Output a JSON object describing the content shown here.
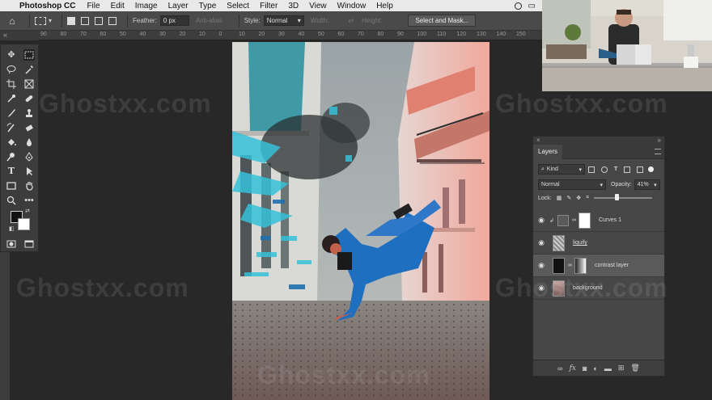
{
  "menubar": {
    "app_name": "Photoshop CC",
    "items": [
      "File",
      "Edit",
      "Image",
      "Layer",
      "Type",
      "Select",
      "Filter",
      "3D",
      "View",
      "Window",
      "Help"
    ]
  },
  "options_bar": {
    "feather_label": "Feather:",
    "feather_value": "0 px",
    "antialias_label": "Anti-alias",
    "style_label": "Style:",
    "style_value": "Normal",
    "width_label": "Width:",
    "height_label": "Height:",
    "select_mask_label": "Select and Mask..."
  },
  "ruler": {
    "ticks": [
      "90",
      "80",
      "70",
      "60",
      "50",
      "40",
      "30",
      "20",
      "10",
      "0",
      "10",
      "20",
      "30",
      "40",
      "50",
      "60",
      "70",
      "80",
      "90",
      "100",
      "110",
      "120",
      "130",
      "140",
      "150"
    ]
  },
  "layers_panel": {
    "title": "Layers",
    "filter_kind": "Kind",
    "blend_mode": "Normal",
    "opacity_label": "Opacity:",
    "opacity_value": "41%",
    "lock_label": "Lock:",
    "layers": [
      {
        "name": "Curves 1",
        "visible": true,
        "underlined": false
      },
      {
        "name": "liquify",
        "visible": true,
        "underlined": true
      },
      {
        "name": "contrast layer",
        "visible": true,
        "underlined": false
      },
      {
        "name": "background",
        "visible": true,
        "underlined": false
      }
    ],
    "footer_fx": "fx"
  },
  "watermark": "Ghostxx.com",
  "colors": {
    "accent_blue": "#2f7fd0",
    "panel_bg": "#474747",
    "app_bg": "#282828"
  }
}
